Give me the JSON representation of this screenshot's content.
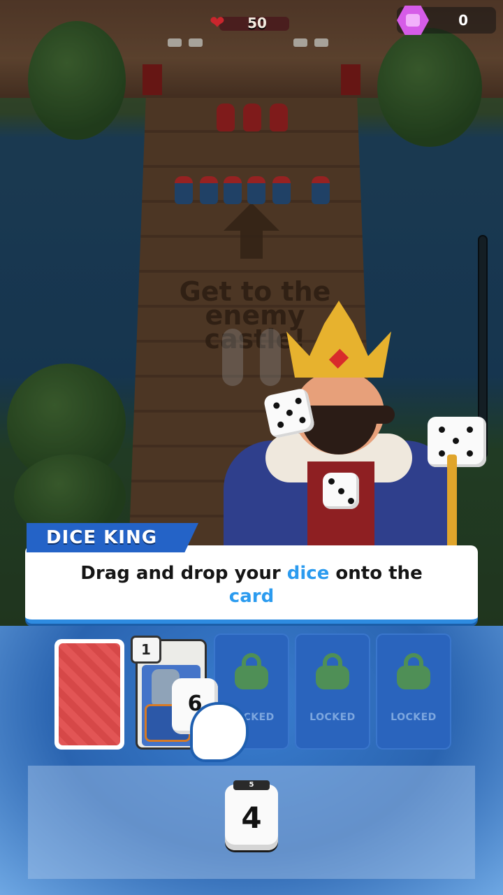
{
  "hud": {
    "castle_hp": "50",
    "gems": "0"
  },
  "board": {
    "hint_text": "Get to the enemy castle!"
  },
  "dialog": {
    "speaker": "DICE KING",
    "text_part1": "Drag and drop your ",
    "text_hl1": "dice",
    "text_part2": " onto the",
    "text_hl2": "card"
  },
  "hand": {
    "card_slots": [
      {
        "type": "card-back"
      },
      {
        "type": "unit",
        "name": "knight",
        "level": "1"
      },
      {
        "type": "locked",
        "label": "LOCKED"
      },
      {
        "type": "locked",
        "label": "LOCKED"
      },
      {
        "type": "locked",
        "label": "LOCKED"
      }
    ],
    "dragged_die_value": "6"
  },
  "dice_tray": {
    "die_value": "4",
    "die_top_value": "5"
  },
  "colors": {
    "accent_blue": "#2b9bef",
    "name_tag": "#2463c7",
    "gem": "#d65ce8",
    "heart": "#c9262d"
  }
}
